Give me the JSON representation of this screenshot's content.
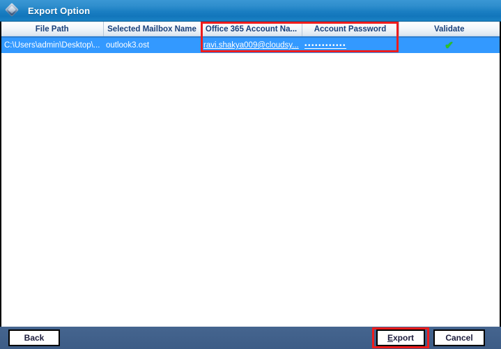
{
  "window": {
    "title": "Export Option",
    "icon": "app-gem-icon"
  },
  "table": {
    "columns": [
      {
        "label": "File Path",
        "key": "file_path"
      },
      {
        "label": "Selected Mailbox Name",
        "key": "mailbox_name"
      },
      {
        "label": "Office 365 Account Na...",
        "key": "account_name"
      },
      {
        "label": "Account Password",
        "key": "password"
      },
      {
        "label": "Validate",
        "key": "validate"
      }
    ],
    "rows": [
      {
        "file_path": "C:\\Users\\admin\\Desktop\\...",
        "mailbox_name": "outlook3.ost",
        "account_name": "ravi.shakya009@cloudsy...",
        "password": "••••••••••••",
        "validate": "✔",
        "selected": true
      }
    ]
  },
  "footer": {
    "back_label": "Back",
    "export_label_accel": "E",
    "export_label_rest": "xport",
    "cancel_label": "Cancel"
  },
  "colors": {
    "titlebar_blue": "#1a7ec2",
    "row_selected": "#3399ff",
    "footer_blue": "#41618f",
    "highlight_red": "#ee1c1c",
    "check_green": "#2ec422",
    "header_text": "#19407a"
  }
}
